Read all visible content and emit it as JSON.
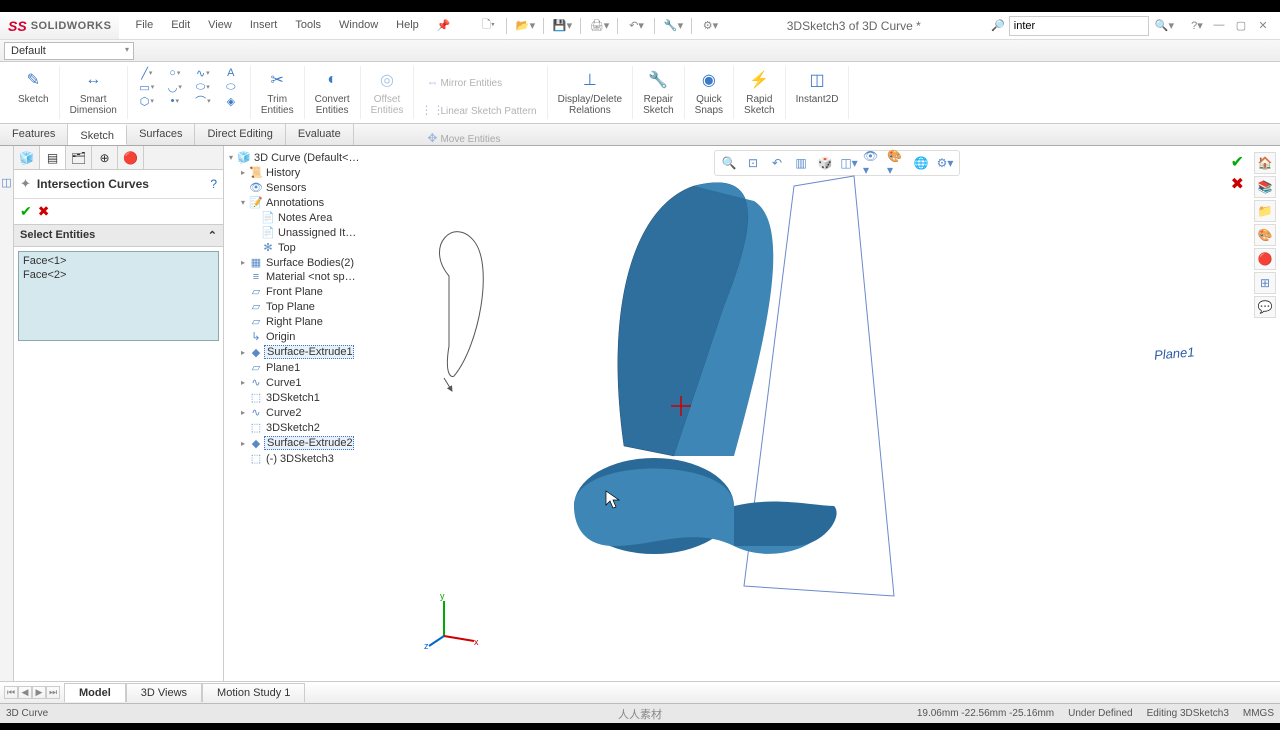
{
  "app": {
    "brand": "SOLIDWORKS",
    "document_title": "3DSketch3 of 3D Curve *",
    "search_value": "inter"
  },
  "menus": {
    "file": "File",
    "edit": "Edit",
    "view": "View",
    "insert": "Insert",
    "tools": "Tools",
    "window": "Window",
    "help": "Help"
  },
  "default_combo": "Default",
  "ribbon": {
    "sketch": "Sketch",
    "smart_dimension": "Smart\nDimension",
    "trim_entities": "Trim\nEntities",
    "convert_entities": "Convert\nEntities",
    "offset_entities": "Offset\nEntities",
    "mirror_entities": "Mirror Entities",
    "linear_pattern": "Linear Sketch Pattern",
    "move_entities": "Move Entities",
    "display_relations": "Display/Delete\nRelations",
    "repair_sketch": "Repair\nSketch",
    "quick_snaps": "Quick\nSnaps",
    "rapid_sketch": "Rapid\nSketch",
    "instant2d": "Instant2D"
  },
  "tabs": {
    "features": "Features",
    "sketch": "Sketch",
    "surfaces": "Surfaces",
    "direct_editing": "Direct Editing",
    "evaluate": "Evaluate"
  },
  "property_manager": {
    "title": "Intersection Curves",
    "section": "Select Entities",
    "selections": [
      "Face<1>",
      "Face<2>"
    ]
  },
  "tree": {
    "root": "3D Curve  (Default<…",
    "history": "History",
    "sensors": "Sensors",
    "annotations": "Annotations",
    "notes_area": "Notes Area",
    "unassigned": "Unassigned It…",
    "top_anno": "Top",
    "surface_bodies": "Surface Bodies(2)",
    "material": "Material  <not sp…",
    "front_plane": "Front Plane",
    "top_plane": "Top Plane",
    "right_plane": "Right Plane",
    "origin": "Origin",
    "surf_extrude1": "Surface-Extrude1",
    "plane1": "Plane1",
    "curve1": "Curve1",
    "sketch1_3d": "3DSketch1",
    "curve2": "Curve2",
    "sketch2_3d": "3DSketch2",
    "surf_extrude2": "Surface-Extrude2",
    "sketch3_3d": "(-) 3DSketch3"
  },
  "view3d": {
    "plane_label": "Plane1"
  },
  "bottom_tabs": {
    "model": "Model",
    "views3d": "3D Views",
    "motion": "Motion Study 1"
  },
  "statusbar": {
    "doc": "3D Curve",
    "watermark": "人人素材",
    "coords": "19.06mm     -22.56mm -25.16mm",
    "state": "Under Defined",
    "mode": "Editing 3DSketch3",
    "units": "MMGS"
  }
}
